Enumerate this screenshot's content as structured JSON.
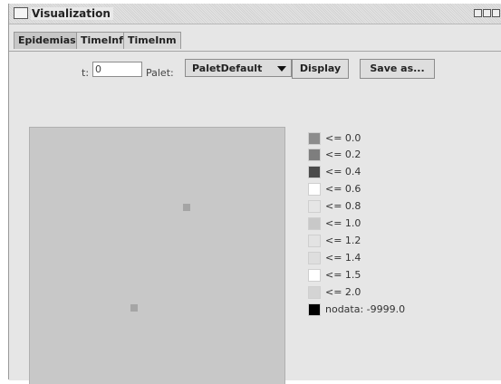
{
  "window": {
    "title": "Visualization"
  },
  "tabs": [
    {
      "label": "Epidemias",
      "active": true
    },
    {
      "label": "TimeInf",
      "active": false
    },
    {
      "label": "TimeInm",
      "active": false
    }
  ],
  "controls": {
    "t_label": "t:",
    "t_value": "0",
    "palet_label": "Palet:",
    "palet_value": "PaletDefault",
    "display_button": "Display",
    "save_button": "Save as..."
  },
  "legend": [
    {
      "label": "<= 0.0",
      "color": "#8c8c8c"
    },
    {
      "label": "<= 0.2",
      "color": "#7e7e7e"
    },
    {
      "label": "<= 0.4",
      "color": "#4a4a4a"
    },
    {
      "label": "<= 0.6",
      "color": "#ffffff"
    },
    {
      "label": "<= 0.8",
      "color": "#e6e6e6"
    },
    {
      "label": "<= 1.0",
      "color": "#c8c8c8"
    },
    {
      "label": "<= 1.2",
      "color": "#e3e3e3"
    },
    {
      "label": "<= 1.4",
      "color": "#dedede"
    },
    {
      "label": "<= 1.5",
      "color": "#ffffff"
    },
    {
      "label": "<= 2.0",
      "color": "#d4d4d4"
    },
    {
      "label": "nodata: -9999.0",
      "color": "#000000"
    }
  ]
}
